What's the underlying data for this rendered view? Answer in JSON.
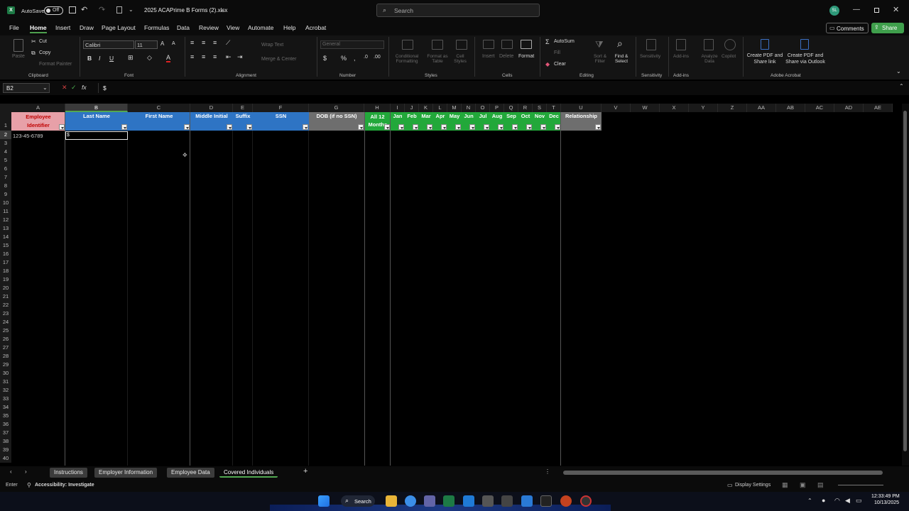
{
  "titlebar": {
    "autosave_label": "AutoSave",
    "autosave_state": "Off",
    "filename": "2025 ACAPrime B Forms (2).xlsx",
    "search_placeholder": "Search",
    "user_initials": "SL"
  },
  "menu": {
    "items": [
      "File",
      "Home",
      "Insert",
      "Draw",
      "Page Layout",
      "Formulas",
      "Data",
      "Review",
      "View",
      "Automate",
      "Help",
      "Acrobat"
    ],
    "active": "Home",
    "comments_label": "Comments",
    "share_label": "Share"
  },
  "ribbon": {
    "clipboard": {
      "paste": "Paste",
      "cut": "Cut",
      "copy": "Copy",
      "format_painter": "Format Painter",
      "group": "Clipboard"
    },
    "font": {
      "name": "Calibri",
      "size": "11",
      "group": "Font"
    },
    "alignment": {
      "wrap": "Wrap Text",
      "merge": "Merge & Center",
      "group": "Alignment"
    },
    "number": {
      "format": "General",
      "group": "Number"
    },
    "styles": {
      "conditional": "Conditional Formatting",
      "format_table": "Format as Table",
      "cell_styles": "Cell Styles",
      "group": "Styles"
    },
    "cells": {
      "insert": "Insert",
      "delete": "Delete",
      "format": "Format",
      "group": "Cells"
    },
    "editing": {
      "autosum": "AutoSum",
      "fill": "Fill",
      "clear": "Clear",
      "sort": "Sort & Filter",
      "find": "Find & Select",
      "group": "Editing"
    },
    "sensitivity": {
      "label": "Sensitivity",
      "group": "Sensitivity"
    },
    "addins": {
      "addins": "Add-ins",
      "analyze": "Analyze Data",
      "copilot": "Copilot",
      "group": "Add-ins"
    },
    "acrobat": {
      "create_pdf": "Create PDF and Share link",
      "create_pdf_outlook": "Create PDF and Share via Outlook",
      "group": "Adobe Acrobat"
    }
  },
  "formula_bar": {
    "name_box": "B2",
    "fx": "fx",
    "content": "$"
  },
  "columns": [
    "A",
    "B",
    "C",
    "D",
    "E",
    "F",
    "G",
    "H",
    "I",
    "J",
    "K",
    "L",
    "M",
    "N",
    "O",
    "P",
    "Q",
    "R",
    "S",
    "T",
    "U",
    "V",
    "W",
    "X",
    "Y",
    "Z",
    "AA",
    "AB",
    "AC",
    "AD",
    "AE"
  ],
  "headers": {
    "a": "Employee Identifier",
    "b": "Last Name",
    "c": "First Name",
    "d": "Middle Initial",
    "e": "Suffix",
    "f": "SSN",
    "g": "DOB (if no SSN)",
    "h": "All 12 Months",
    "months": [
      "Jan",
      "Feb",
      "Mar",
      "Apr",
      "May",
      "Jun",
      "Jul",
      "Aug",
      "Sep",
      "Oct",
      "Nov",
      "Dec"
    ],
    "u": "Relationship"
  },
  "cells": {
    "a2": "123-45-6789",
    "b2": "$"
  },
  "rows": [
    "1",
    "2",
    "3",
    "4",
    "5",
    "6",
    "7",
    "8",
    "9",
    "10",
    "11",
    "12",
    "13",
    "14",
    "15",
    "16",
    "17",
    "18",
    "19",
    "20",
    "21",
    "22",
    "23",
    "24",
    "25",
    "26",
    "27",
    "28",
    "29",
    "30",
    "31",
    "32",
    "33",
    "34",
    "35",
    "36",
    "37",
    "38",
    "39",
    "40"
  ],
  "sheets": [
    "Instructions",
    "Employer Information",
    "Employee Data",
    "Covered Individuals"
  ],
  "active_sheet": "Covered Individuals",
  "status": {
    "mode": "Enter",
    "accessibility": "Accessibility: Investigate",
    "display": "Display Settings"
  },
  "taskbar": {
    "search": "Search",
    "time": "12:33:49 PM",
    "date": "10/13/2025"
  },
  "colors": {
    "blue_header": "#2e74c4",
    "green_header": "#22a83a",
    "red_header": "#e7a0a8",
    "accent": "#52a852"
  }
}
